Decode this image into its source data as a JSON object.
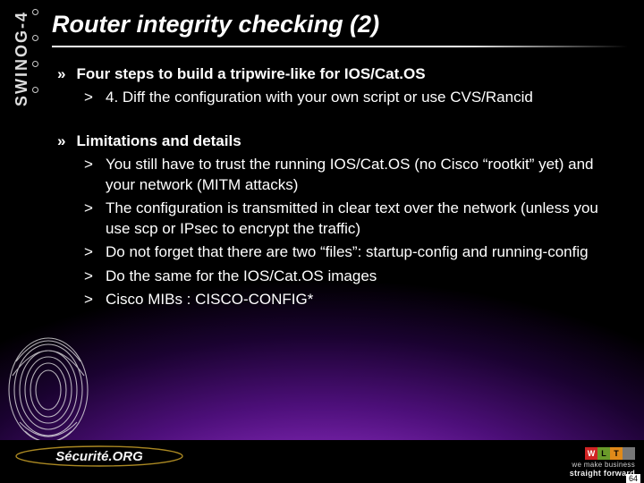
{
  "event_label": "SWINOG-4",
  "title": "Router integrity checking (2)",
  "sections": [
    {
      "heading": "Four steps to build a tripwire-like for IOS/Cat.OS",
      "items": [
        "4. Diff the configuration with your own script or use CVS/Rancid"
      ]
    },
    {
      "heading": "Limitations and details",
      "items": [
        "You still have to trust the running IOS/Cat.OS (no Cisco “rootkit” yet) and your network (MITM attacks)",
        "The configuration is transmitted in clear text over the network (unless you use scp or IPsec to encrypt the traffic)",
        "Do not forget that there are two “files”: startup-config and running-config",
        "Do the same for the IOS/Cat.OS images",
        "Cisco MIBs : CISCO-CONFIG*"
      ]
    }
  ],
  "bullet_lvl1": "»",
  "bullet_lvl2": ">",
  "footer": {
    "logo_text": "Sécurité.ORG",
    "badge_letters": [
      "W",
      "L",
      "T"
    ],
    "tagline_small": "we make business",
    "tagline_bold": "straight forward",
    "page_number": "64"
  }
}
